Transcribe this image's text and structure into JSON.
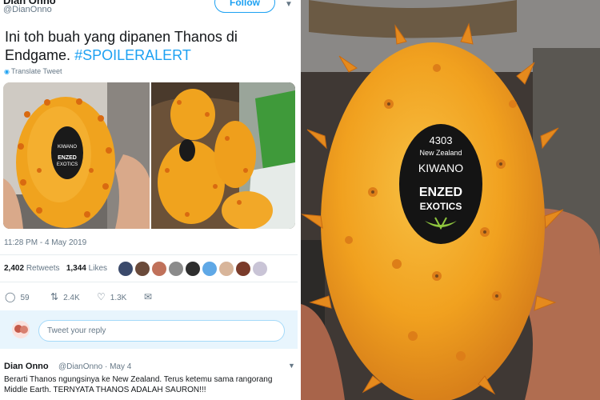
{
  "tweet": {
    "author_name": "Dian Onno",
    "author_handle": "@DianOnno",
    "follow_label": "Follow",
    "text_main": "Ini toh buah yang dipanen Thanos di Endgame.",
    "hashtag": "#SPOILERALERT",
    "translate_label": "Translate Tweet",
    "timestamp": "11:28 PM - 4 May 2019",
    "retweets_count": "2,402",
    "retweets_label": "Retweets",
    "likes_count": "1,344",
    "likes_label": "Likes",
    "reply_count": "59",
    "retweet_count_short": "2.4K",
    "like_count_short": "1.3K",
    "reply_placeholder": "Tweet your reply",
    "colors": {
      "accent": "#1da1f2",
      "text": "#14171a",
      "muted": "#657786"
    }
  },
  "comment": {
    "author_name": "Dian Onno",
    "meta": "@DianOnno · May 4",
    "text": "Berarti Thanos ngungsinya ke New Zealand. Terus ketemu sama rangorang Middle Earth. TERNYATA THANOS ADALAH SAURON!!!"
  },
  "sticker": {
    "code": "4303",
    "origin": "New Zealand",
    "product": "KIWANO",
    "brand_line1": "ENZED",
    "brand_line2": "EXOTICS"
  },
  "icons": [
    "globe-icon",
    "reply-icon",
    "retweet-icon",
    "like-icon",
    "dm-icon",
    "chevron-down-icon"
  ]
}
